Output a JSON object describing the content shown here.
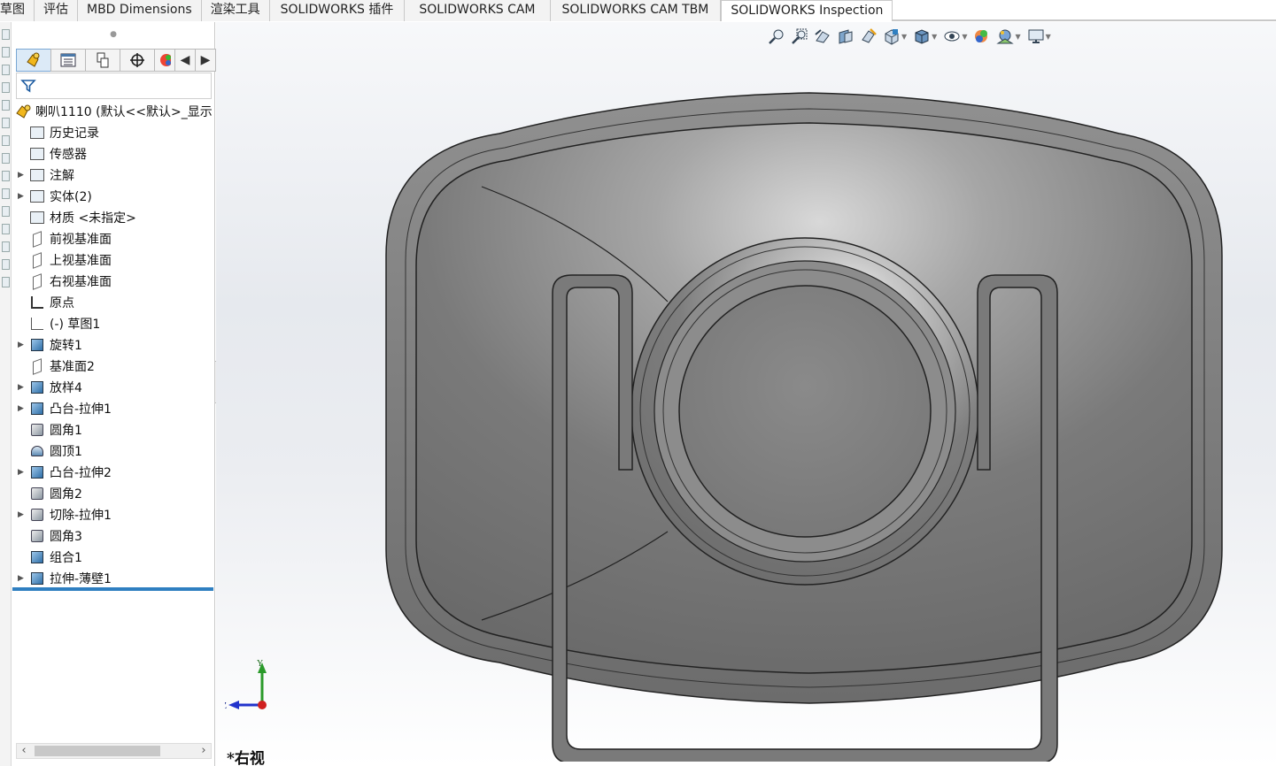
{
  "tabs": [
    {
      "label": "草图",
      "active": false
    },
    {
      "label": "评估",
      "active": false
    },
    {
      "label": "MBD Dimensions",
      "active": false
    },
    {
      "label": "渲染工具",
      "active": false
    },
    {
      "label": "SOLIDWORKS 插件",
      "active": false
    },
    {
      "label": "SOLIDWORKS CAM",
      "active": false
    },
    {
      "label": "SOLIDWORKS CAM TBM",
      "active": false
    },
    {
      "label": "SOLIDWORKS Inspection",
      "active": true
    }
  ],
  "feature_tree": {
    "root_label": "喇叭1110  (默认<<默认>_显示",
    "items": [
      {
        "label": "历史记录",
        "icon": "history-icon",
        "expandable": false
      },
      {
        "label": "传感器",
        "icon": "sensor-icon",
        "expandable": false
      },
      {
        "label": "注解",
        "icon": "annotation-icon",
        "expandable": true
      },
      {
        "label": "实体(2)",
        "icon": "solid-bodies-icon",
        "expandable": true
      },
      {
        "label": "材质 <未指定>",
        "icon": "material-icon",
        "expandable": false
      },
      {
        "label": "前视基准面",
        "icon": "plane-icon",
        "expandable": false
      },
      {
        "label": "上视基准面",
        "icon": "plane-icon",
        "expandable": false
      },
      {
        "label": "右视基准面",
        "icon": "plane-icon",
        "expandable": false
      },
      {
        "label": "原点",
        "icon": "origin-icon",
        "expandable": false
      },
      {
        "label": "(-) 草图1",
        "icon": "sketch-icon",
        "expandable": false
      },
      {
        "label": "旋转1",
        "icon": "revolve-icon",
        "expandable": true
      },
      {
        "label": "基准面2",
        "icon": "plane-icon",
        "expandable": false
      },
      {
        "label": "放样4",
        "icon": "loft-icon",
        "expandable": true
      },
      {
        "label": "凸台-拉伸1",
        "icon": "extrude-icon",
        "expandable": true
      },
      {
        "label": "圆角1",
        "icon": "fillet-icon",
        "expandable": false
      },
      {
        "label": "圆顶1",
        "icon": "dome-icon",
        "expandable": false
      },
      {
        "label": "凸台-拉伸2",
        "icon": "extrude-icon",
        "expandable": true
      },
      {
        "label": "圆角2",
        "icon": "fillet-icon",
        "expandable": false
      },
      {
        "label": "切除-拉伸1",
        "icon": "cut-extrude-icon",
        "expandable": true
      },
      {
        "label": "圆角3",
        "icon": "fillet-icon",
        "expandable": false
      },
      {
        "label": "组合1",
        "icon": "combine-icon",
        "expandable": false
      },
      {
        "label": "拉伸-薄壁1",
        "icon": "thin-extrude-icon",
        "expandable": true
      }
    ]
  },
  "view_toolbar": {
    "icons": [
      "zoom-to-fit-icon",
      "zoom-to-area-icon",
      "previous-view-icon",
      "section-view-icon",
      "dynamic-annotation-icon",
      "view-orientation-icon",
      "display-style-icon",
      "hide-show-items-icon",
      "edit-appearance-icon",
      "apply-scene-icon",
      "view-settings-icon"
    ]
  },
  "triad": {
    "y": "Y",
    "z": "Z"
  },
  "viewport": {
    "view_label": "*右视"
  },
  "colors": {
    "accent": "#2f7fc1",
    "model_body": "#7d7d7d",
    "model_edge": "#2a2a2a"
  }
}
